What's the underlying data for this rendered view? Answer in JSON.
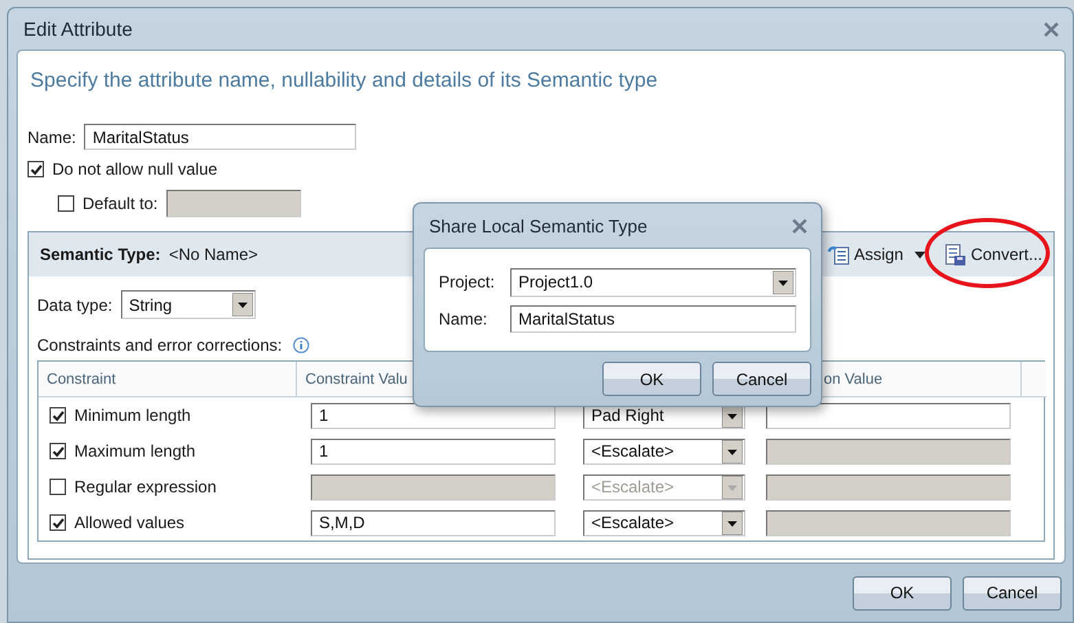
{
  "window": {
    "title": "Edit Attribute"
  },
  "heading": "Specify the attribute name, nullability and details of its Semantic type",
  "name_field": {
    "label": "Name:",
    "value": "MaritalStatus"
  },
  "not_null": {
    "label": "Do not allow null value",
    "checked": true
  },
  "default_to": {
    "label": "Default to:",
    "checked": false
  },
  "semantic_type": {
    "label": "Semantic Type:",
    "value": "<No Name>",
    "actions": [
      {
        "kind": "assign",
        "label": "Assign",
        "highlighted": false
      },
      {
        "kind": "convert",
        "label": "Convert...",
        "highlighted": true
      }
    ]
  },
  "data_type": {
    "label": "Data type:",
    "value": "String"
  },
  "constraints": {
    "label": "Constraints and error corrections:",
    "columns": [
      "Constraint",
      "Constraint Valu",
      "on Value"
    ],
    "rows": [
      {
        "label": "Minimum length",
        "checked": true,
        "value": "1",
        "value_disabled": false,
        "correction": "Pad Right",
        "correction_disabled": false,
        "correction_value_disabled": false
      },
      {
        "label": "Maximum length",
        "checked": true,
        "value": "1",
        "value_disabled": false,
        "correction": "<Escalate>",
        "correction_disabled": false,
        "correction_value_disabled": true
      },
      {
        "label": "Regular expression",
        "checked": false,
        "value_disabled": true,
        "correction": "<Escalate>",
        "correction_disabled": true,
        "correction_value_disabled": true
      },
      {
        "label": "Allowed values",
        "checked": true,
        "value": "S,M,D",
        "value_disabled": false,
        "correction": "<Escalate>",
        "correction_disabled": false,
        "correction_value_disabled": true
      }
    ]
  },
  "share_dialog": {
    "title": "Share Local Semantic Type",
    "project": {
      "label": "Project:",
      "value": "Project1.0"
    },
    "name": {
      "label": "Name:",
      "value": "MaritalStatus"
    },
    "buttons": [
      "OK",
      "Cancel"
    ]
  },
  "buttons": [
    "OK",
    "Cancel"
  ]
}
